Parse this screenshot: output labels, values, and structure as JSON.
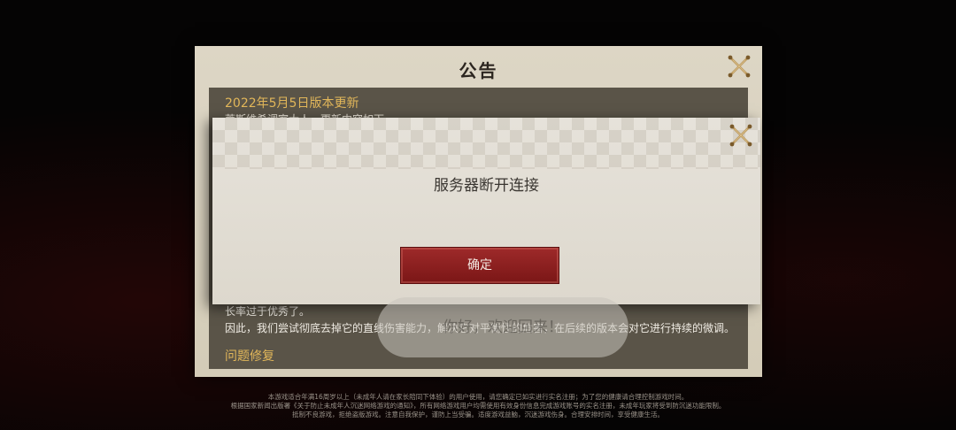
{
  "announcement": {
    "title": "公告",
    "heading": "2022年5月5日版本更新",
    "partial_line": "蒂斯维希调室大人，更新内容如下",
    "body_line1": "长率过于优秀了。",
    "body_line2": "因此，我们尝试彻底去掉它的直线伤害能力，解决它对平衡性的危害，在后续的版本会对它进行持续的微调。",
    "section_fix": "问题修复"
  },
  "dialog": {
    "message": "服务器断开连接",
    "confirm_label": "确定"
  },
  "toast": {
    "text": "你好，欢迎回来！"
  },
  "footer": {
    "line1": "本游戏适合年满16周岁以上（未成年人请在家长陪同下体验）的用户使用，请您确定已如实进行实名注册；为了您的健康请合理控制游戏时间。",
    "line2": "根据国家新闻出版署《关于防止未成年人沉迷网络游戏的通知》，所有网络游戏用户均需使用有效身份信息完成游戏账号的实名注册，未成年玩家将受到防沉迷功能限制。",
    "line3": "抵制不良游戏，拒绝盗版游戏。注意自我保护，谨防上当受骗。适度游戏益脑，沉迷游戏伤身。合理安排时间，享受健康生活。"
  }
}
